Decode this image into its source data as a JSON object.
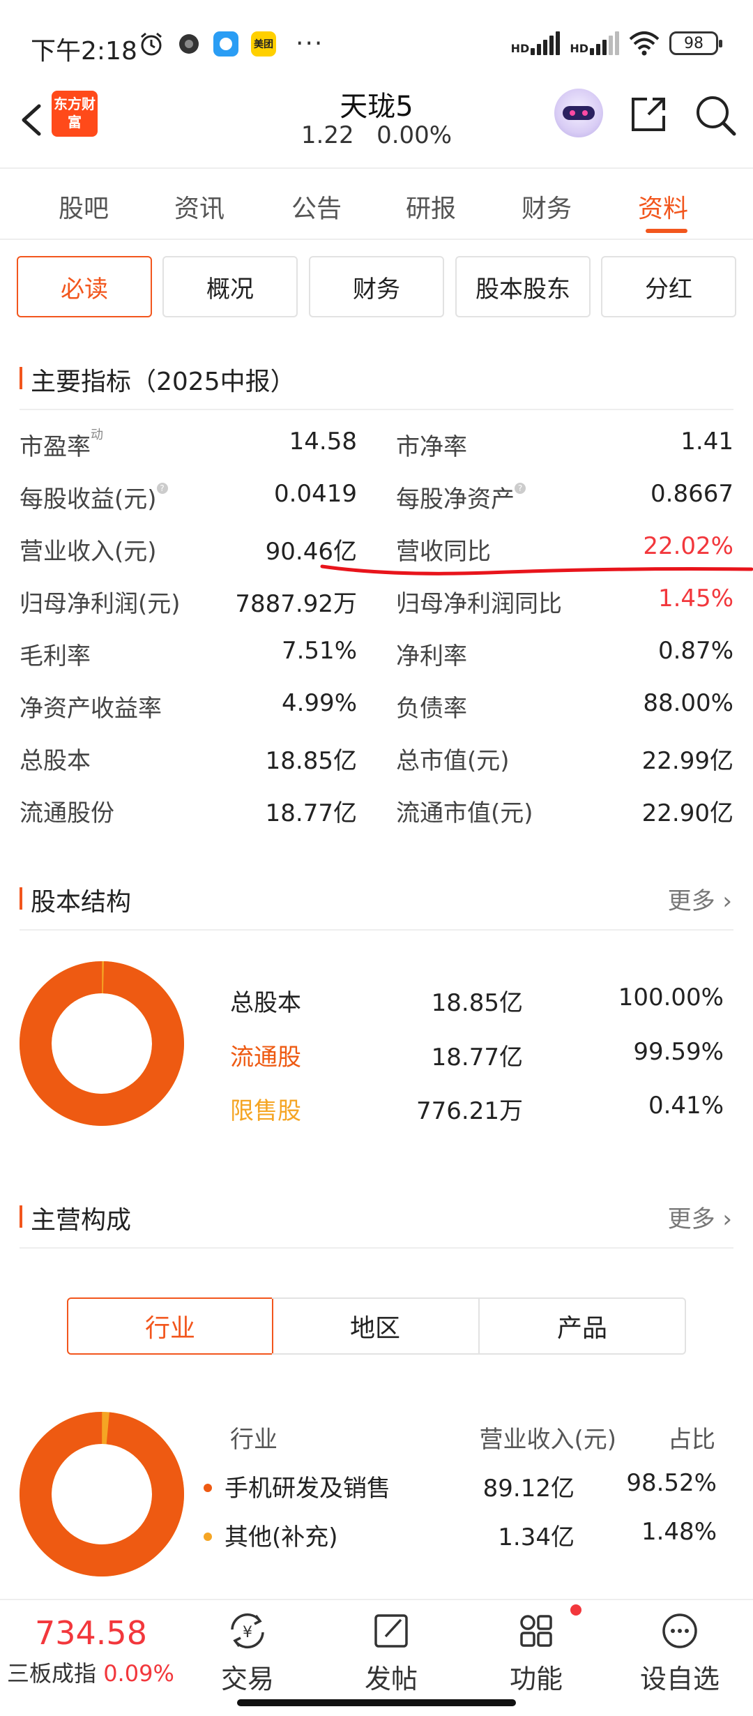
{
  "status_bar": {
    "time": "下午2:18",
    "app_meituan": "美团",
    "more": "···",
    "signal1": "HD",
    "signal2": "HD",
    "battery": "98"
  },
  "header": {
    "logo_text": "东方财富",
    "title": "天珑5",
    "price": "1.22",
    "change": "0.00%"
  },
  "tabs": [
    {
      "label": "股吧"
    },
    {
      "label": "资讯"
    },
    {
      "label": "公告"
    },
    {
      "label": "研报"
    },
    {
      "label": "财务"
    },
    {
      "label": "资料"
    }
  ],
  "active_tab": "资料",
  "subtabs": [
    {
      "label": "必读"
    },
    {
      "label": "概况"
    },
    {
      "label": "财务"
    },
    {
      "label": "股本股东"
    },
    {
      "label": "分红"
    }
  ],
  "indicators": {
    "title": "主要指标（2025中报）",
    "rows": [
      {
        "l_label": "市盈率",
        "l_sup": "动",
        "l_value": "14.58",
        "r_label": "市净率",
        "r_value": "1.41"
      },
      {
        "l_label": "每股收益(元)",
        "l_value": "0.0419",
        "r_label": "每股净资产",
        "r_value": "0.8667"
      },
      {
        "l_label": "营业收入(元)",
        "l_value": "90.46亿",
        "r_label": "营收同比",
        "r_value": "22.02%"
      },
      {
        "l_label": "归母净利润(元)",
        "l_value": "7887.92万",
        "r_label": "归母净利润同比",
        "r_value": "1.45%"
      },
      {
        "l_label": "毛利率",
        "l_value": "7.51%",
        "r_label": "净利率",
        "r_value": "0.87%"
      },
      {
        "l_label": "净资产收益率",
        "l_value": "4.99%",
        "r_label": "负债率",
        "r_value": "88.00%"
      },
      {
        "l_label": "总股本",
        "l_value": "18.85亿",
        "r_label": "总市值(元)",
        "r_value": "22.99亿"
      },
      {
        "l_label": "流通股份",
        "l_value": "18.77亿",
        "r_label": "流通市值(元)",
        "r_value": "22.90亿"
      }
    ]
  },
  "share_structure": {
    "title": "股本结构",
    "more": "更多",
    "rows": [
      {
        "label": "总股本",
        "amount": "18.85亿",
        "pct": "100.00%"
      },
      {
        "label": "流通股",
        "amount": "18.77亿",
        "pct": "99.59%"
      },
      {
        "label": "限售股",
        "amount": "776.21万",
        "pct": "0.41%"
      }
    ],
    "donut_fraction": 0.9959
  },
  "main_business": {
    "title": "主营构成",
    "more": "更多",
    "segments": [
      {
        "label": "行业"
      },
      {
        "label": "地区"
      },
      {
        "label": "产品"
      }
    ],
    "header": {
      "category": "行业",
      "revenue": "营业收入(元)",
      "share": "占比"
    },
    "rows": [
      {
        "label": "手机研发及销售",
        "revenue": "89.12亿",
        "share": "98.52%"
      },
      {
        "label": "其他(补充)",
        "revenue": "1.34亿",
        "share": "1.48%"
      }
    ],
    "donut_fraction": 0.9852
  },
  "bottom_nav": {
    "index_value": "734.58",
    "index_name": "三板成指",
    "index_change": "0.09%",
    "items": [
      {
        "label": "交易"
      },
      {
        "label": "发帖"
      },
      {
        "label": "功能"
      },
      {
        "label": "设自选"
      }
    ],
    "trade_symbol": "¥"
  },
  "colors": {
    "accent": "#f2561d",
    "rise": "#f2373c",
    "donut_main": "#ee5a12",
    "donut_minor": "#f5a524"
  }
}
